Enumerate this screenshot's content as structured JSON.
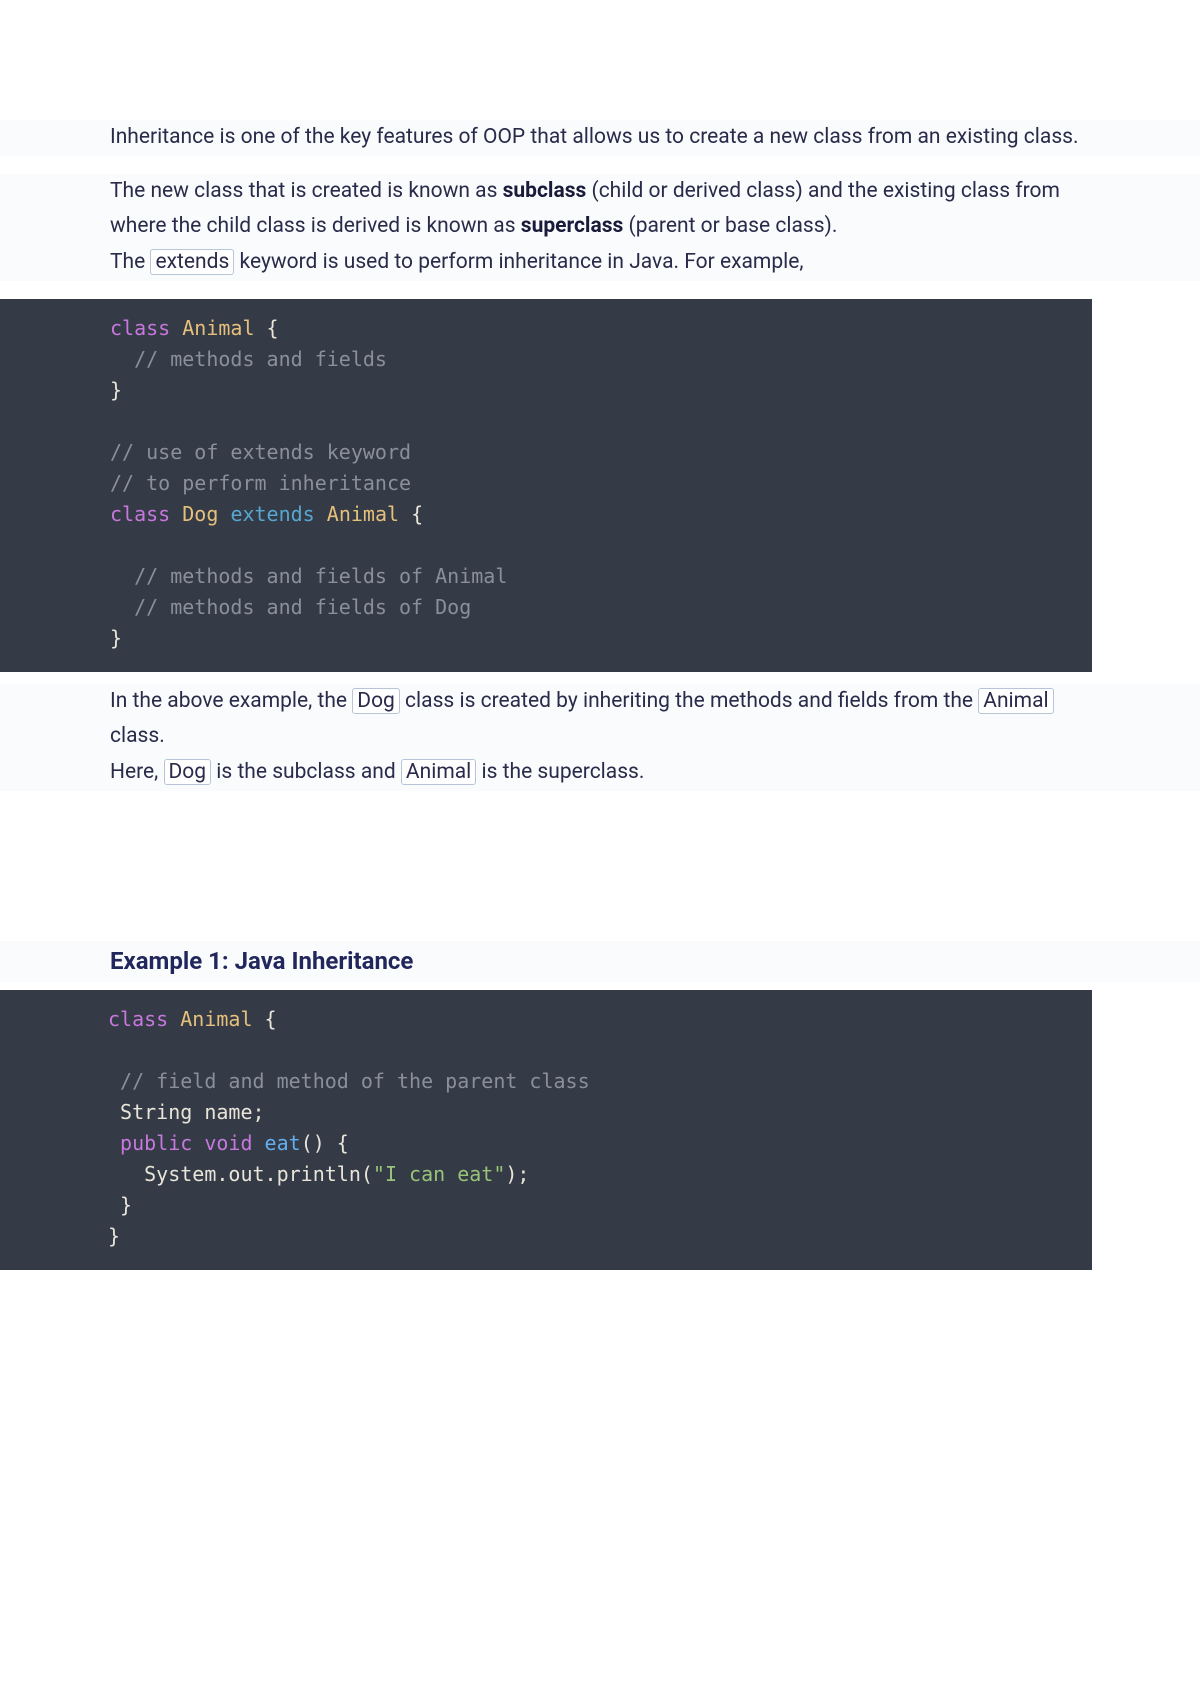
{
  "intro": {
    "p1": "Inheritance is one of the key features of OOP that allows us to create a new class from an existing class.",
    "p2_pre": "The new class that is created is known as ",
    "p2_b1": "subclass",
    "p2_mid": " (child or derived class) and the existing class from where the child class is derived is known as ",
    "p2_b2": "superclass",
    "p2_post": " (parent or base class).",
    "p3_pre": "The ",
    "p3_code": "extends",
    "p3_post": " keyword is used to perform inheritance in Java. For example,"
  },
  "code1": {
    "l1_kw": "class",
    "l1_name": "Animal",
    "l1_brace": " {",
    "l2": "  // methods and fields",
    "l3": "}",
    "l5": "// use of extends keyword",
    "l6": "// to perform inheritance",
    "l7_kw": "class",
    "l7_name": "Dog",
    "l7_ext": "extends",
    "l7_name2": "Animal",
    "l7_brace": " {",
    "l9": "  // methods and fields of Animal",
    "l10": "  // methods and fields of Dog",
    "l11": "}"
  },
  "after": {
    "p1_pre": "In the above example, the ",
    "p1_c1": "Dog",
    "p1_mid": " class is created by inheriting the methods and fields from the ",
    "p1_c2": "Animal",
    "p1_post": " class.",
    "p2_pre": "Here, ",
    "p2_c1": "Dog",
    "p2_mid": " is the subclass and ",
    "p2_c2": "Animal",
    "p2_post": " is the superclass."
  },
  "heading1": "Example 1: Java Inheritance",
  "code2": {
    "l1_kw": "class",
    "l1_name": "Animal",
    "l1_brace": " {",
    "l3": " // field and method of the parent class",
    "l4": " String name;",
    "l5_pub": " public",
    "l5_void": " void",
    "l5_m": " eat",
    "l5_p": "() {",
    "l6_pre": "   System.out.println(",
    "l6_str": "\"I can eat\"",
    "l6_post": ");",
    "l7": " }",
    "l8": "}"
  }
}
